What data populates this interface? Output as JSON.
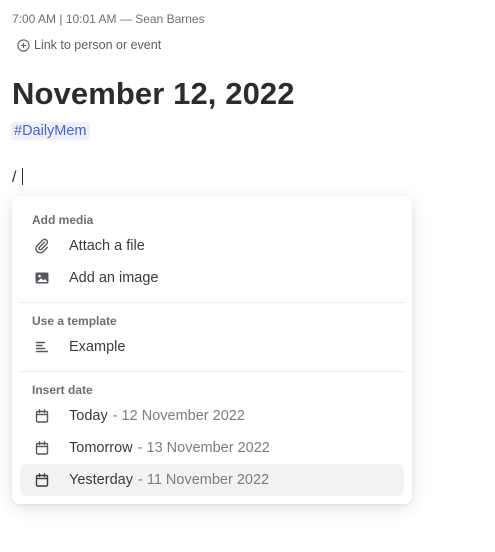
{
  "header": {
    "time_range": "7:00 AM | 10:01 AM",
    "separator": "—",
    "author": "Sean Barnes",
    "link_label": "Link to person or event"
  },
  "note": {
    "title": "November 12, 2022",
    "tag": "#DailyMem",
    "command_input": "/"
  },
  "menu": {
    "sections": [
      {
        "label": "Add media",
        "items": [
          {
            "icon": "paperclip-icon",
            "label": "Attach a file"
          },
          {
            "icon": "image-icon",
            "label": "Add an image"
          }
        ]
      },
      {
        "label": "Use a template",
        "items": [
          {
            "icon": "template-lines-icon",
            "label": "Example"
          }
        ]
      },
      {
        "label": "Insert date",
        "items": [
          {
            "icon": "calendar-icon",
            "label": "Today",
            "date": "- 12 November 2022"
          },
          {
            "icon": "calendar-icon",
            "label": "Tomorrow",
            "date": "- 13 November 2022"
          },
          {
            "icon": "calendar-icon",
            "label": "Yesterday",
            "date": "- 11 November 2022",
            "highlighted": true
          }
        ]
      }
    ]
  },
  "colors": {
    "tag_background": "#eef1fb",
    "tag_text": "#4a63c8",
    "highlight_row": "#f2f2f3"
  }
}
